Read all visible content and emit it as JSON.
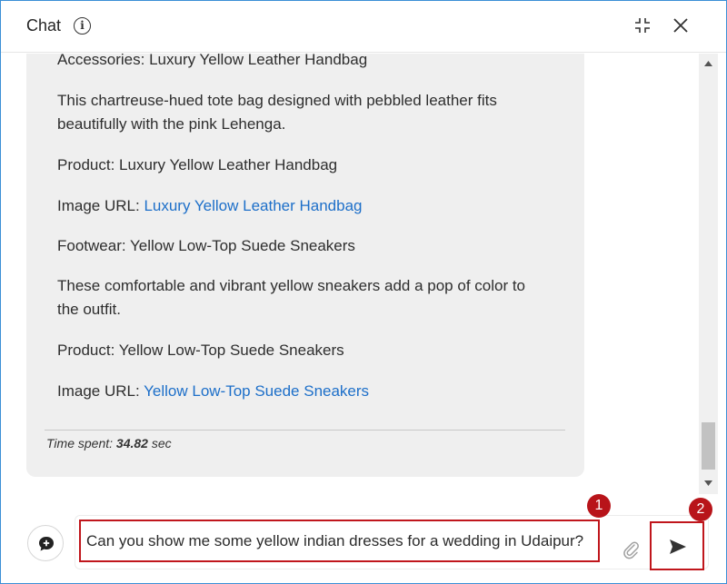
{
  "header": {
    "title": "Chat",
    "info_icon": "i"
  },
  "message": {
    "paragraphs": [
      {
        "text": "Accessories: Luxury Yellow Leather Handbag"
      },
      {
        "text": "This chartreuse-hued tote bag designed with pebbled leather fits beautifully with the pink Lehenga."
      },
      {
        "text": "Product: Luxury Yellow Leather Handbag"
      },
      {
        "prefix": "Image URL: ",
        "link": "Luxury Yellow Leather Handbag"
      },
      {
        "text": "Footwear: Yellow Low-Top Suede Sneakers"
      },
      {
        "text": "These comfortable and vibrant yellow sneakers add a pop of color to the outfit."
      },
      {
        "text": "Product: Yellow Low-Top Suede Sneakers"
      },
      {
        "prefix": "Image URL: ",
        "link": "Yellow Low-Top Suede Sneakers"
      }
    ],
    "time_label": "Time spent:",
    "time_value": "34.82",
    "time_unit": "sec"
  },
  "input": {
    "value": "Can you show me some yellow indian dresses for a wedding in Udaipur?"
  },
  "annotations": {
    "marker_1": "1",
    "marker_2": "2"
  },
  "icons": {
    "info": "info-icon",
    "collapse": "collapse-icon",
    "close": "close-icon",
    "new_chat": "chat-plus-icon",
    "attach": "paperclip-icon",
    "send": "send-icon"
  },
  "colors": {
    "accent_link": "#1d6fc9",
    "highlight": "#c0161c",
    "bubble": "#efefef",
    "window_border": "#3a8fd6"
  }
}
